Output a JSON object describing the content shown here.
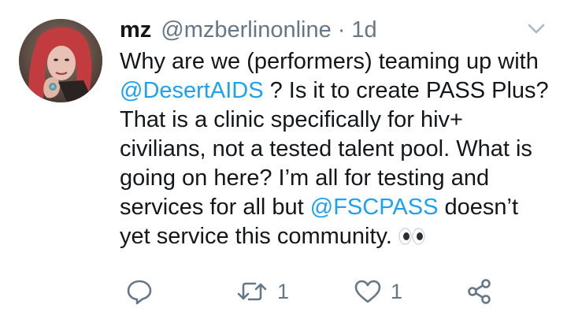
{
  "tweet": {
    "display_name": "mz",
    "handle": "@mzberlinonline",
    "separator": "·",
    "time": "1d",
    "text": {
      "part1": "Why are we (performers) teaming up with ",
      "mention1": "@DesertAIDS",
      "part2": " ? Is it to create PASS Plus? That is a clinic specifically for hiv+ civilians, not a tested talent pool. What is going on here? I’m all for testing and services for all but ",
      "mention2": "@FSCPASS",
      "part3": " doesn’t yet service this community."
    },
    "emoji": "eyes-emoji"
  },
  "actions": {
    "reply_icon": "reply-icon",
    "retweet_icon": "retweet-icon",
    "retweet_count": "1",
    "like_icon": "heart-icon",
    "like_count": "1",
    "share_icon": "share-icon"
  },
  "colors": {
    "link": "#1da1f2",
    "secondary_text": "#657786",
    "primary_text": "#14171a"
  }
}
